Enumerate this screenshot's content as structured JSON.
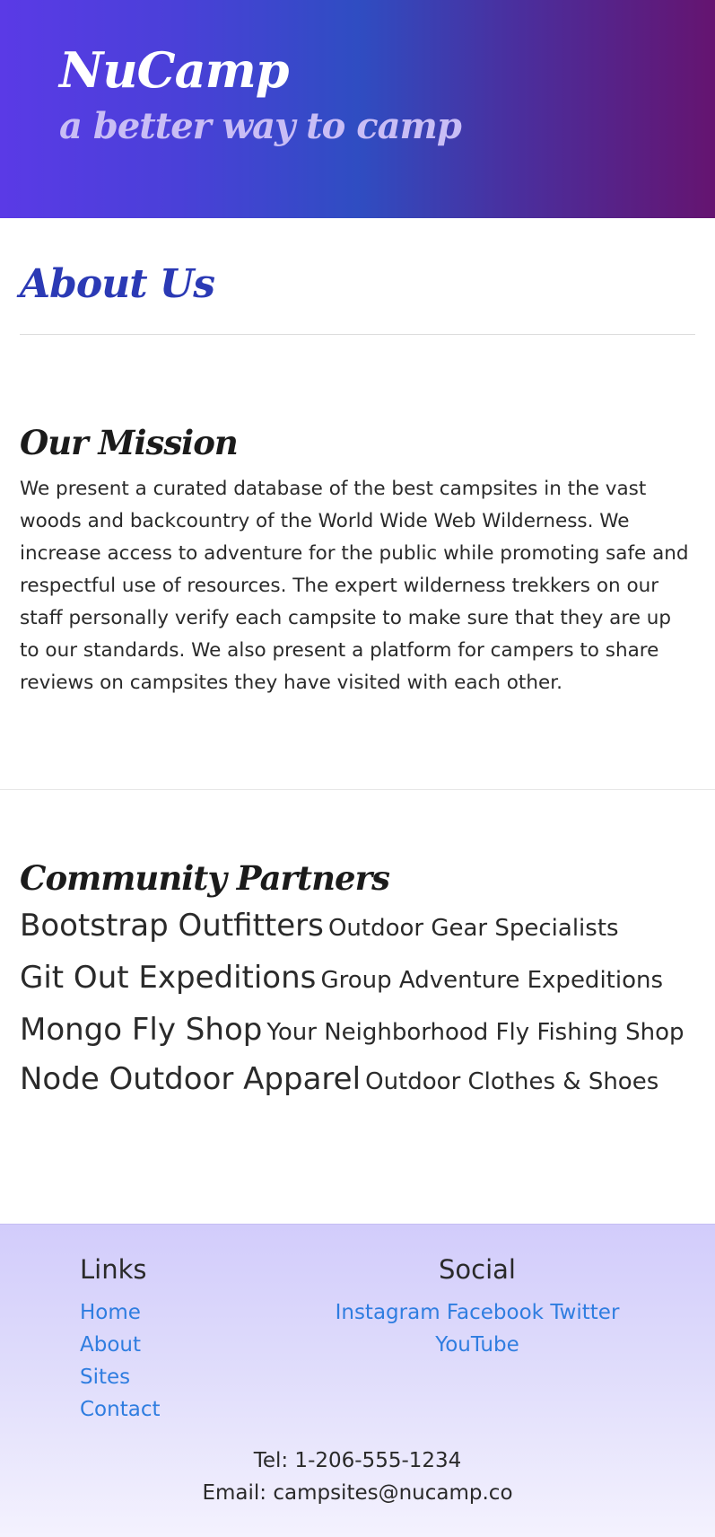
{
  "header": {
    "title": "NuCamp",
    "tagline": "a better way to camp"
  },
  "about": {
    "heading": "About Us"
  },
  "mission": {
    "heading": "Our Mission",
    "text": "We present a curated database of the best campsites in the vast woods and backcountry of the World Wide Web Wilderness. We increase access to adventure for the public while promoting safe and respectful use of resources. The expert wilderness trekkers on our staff personally verify each campsite to make sure that they are up to our standards. We also present a platform for campers to share reviews on campsites they have visited with each other."
  },
  "partners": {
    "heading": "Community Partners",
    "items": [
      {
        "name": "Bootstrap Outfitters",
        "desc": "Outdoor Gear Specialists"
      },
      {
        "name": "Git Out Expeditions",
        "desc": "Group Adventure Expeditions"
      },
      {
        "name": "Mongo Fly Shop",
        "desc": "Your Neighborhood Fly Fishing Shop"
      },
      {
        "name": "Node Outdoor Apparel",
        "desc": "Outdoor Clothes & Shoes"
      }
    ]
  },
  "footer": {
    "links_heading": "Links",
    "links": [
      "Home",
      "About",
      "Sites",
      "Contact"
    ],
    "social_heading": "Social",
    "social": [
      "Instagram",
      "Facebook",
      "Twitter",
      "YouTube"
    ],
    "tel": "Tel: 1-206-555-1234",
    "email": "Email: campsites@nucamp.co"
  },
  "colors": {
    "accent_heading": "#2b3ab5",
    "link": "#2f7de0",
    "header_gradient_start": "#5a3ae6",
    "header_gradient_end": "#651470",
    "footer_bg": "#d2ccfb"
  }
}
